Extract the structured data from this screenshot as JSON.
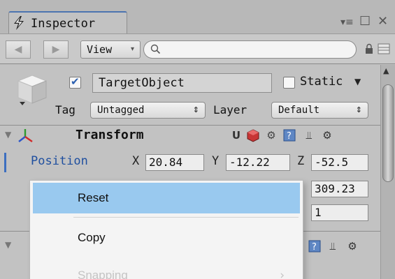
{
  "tab": {
    "title": "Inspector"
  },
  "window_controls": {
    "menu": "▾≡",
    "maximize": "☐",
    "close": "✕"
  },
  "toolbar": {
    "back": "◀",
    "forward": "▶",
    "view_label": "View",
    "view_caret": "▾",
    "search_placeholder": ""
  },
  "object": {
    "name": "TargetObject",
    "active_checked": true,
    "static_label": "Static",
    "static_checked": false,
    "tag_label": "Tag",
    "tag_value": "Untagged",
    "layer_label": "Layer",
    "layer_value": "Default",
    "dropdown_arrow": "⇕"
  },
  "transform": {
    "title": "Transform",
    "position_label": "Position",
    "position": {
      "x_label": "X",
      "x": "20.84",
      "y_label": "Y",
      "y": "-12.22",
      "z_label": "Z",
      "z": "-52.5"
    },
    "rotation_z": "309.23",
    "scale_z": "1"
  },
  "context_menu": {
    "items": [
      {
        "label": "Reset",
        "highlighted": true
      },
      {
        "label": "Copy",
        "highlighted": false
      },
      {
        "label": "Snapping",
        "disabled": true
      }
    ],
    "submenu_arrow": "›"
  },
  "colors": {
    "accent": "#3d6fc0",
    "highlight": "#99c9ef",
    "panel": "#c2c2c2"
  }
}
